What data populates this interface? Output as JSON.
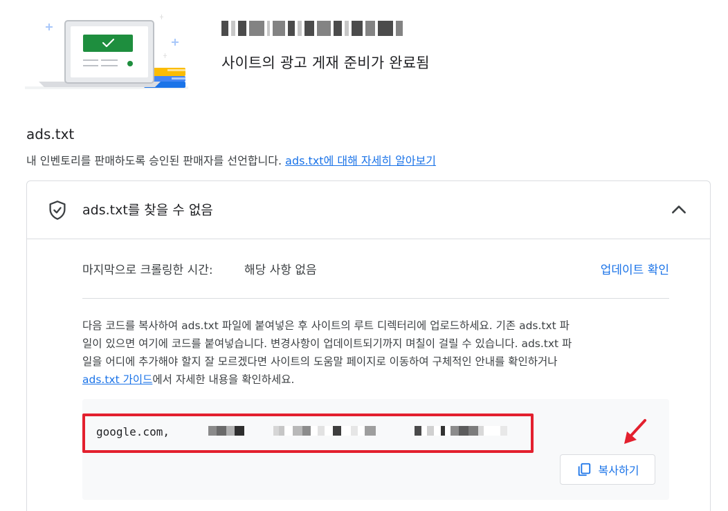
{
  "header": {
    "site_status": "사이트의 광고 게재 준비가 완료됨"
  },
  "ads_txt": {
    "title": "ads.txt",
    "description_prefix": "내 인벤토리를 판매하도록 승인된 판매자를 선언합니다. ",
    "learn_more_link": "ads.txt에 대해 자세히 알아보기"
  },
  "card": {
    "status_title": "ads.txt를 찾을 수 없음",
    "last_crawled_label": "마지막으로 크롤링한 시간:",
    "last_crawled_value": "해당 사항 없음",
    "update_check_link": "업데이트 확인",
    "instructions": {
      "line1": "다음 코드를 복사하여 ads.txt 파일에 붙여넣은 후 사이트의 루트 디렉터리에 업로드하세요. 기존 ads.txt 파",
      "line2": "일이 있으면 여기에 코드를 붙여넣습니다. 변경사항이 업데이트되기까지 며칠이 걸릴 수 있습니다. ads.txt 파",
      "line3": "일을 어디에 추가해야 할지 잘 모르겠다면 사이트의 도움말 페이지로 이동하여 구체적인 안내를 확인하거나",
      "guide_link": "ads.txt 가이드",
      "line4_suffix": "에서 자세한 내용을 확인하세요."
    },
    "code_text": "google.com,",
    "copy_button_label": "복사하기"
  },
  "colors": {
    "accent_blue": "#1a73e8",
    "highlight_red": "#e3202e",
    "code_panel_bg": "#f8f9fa",
    "illustration_green": "#1e8e3e"
  }
}
